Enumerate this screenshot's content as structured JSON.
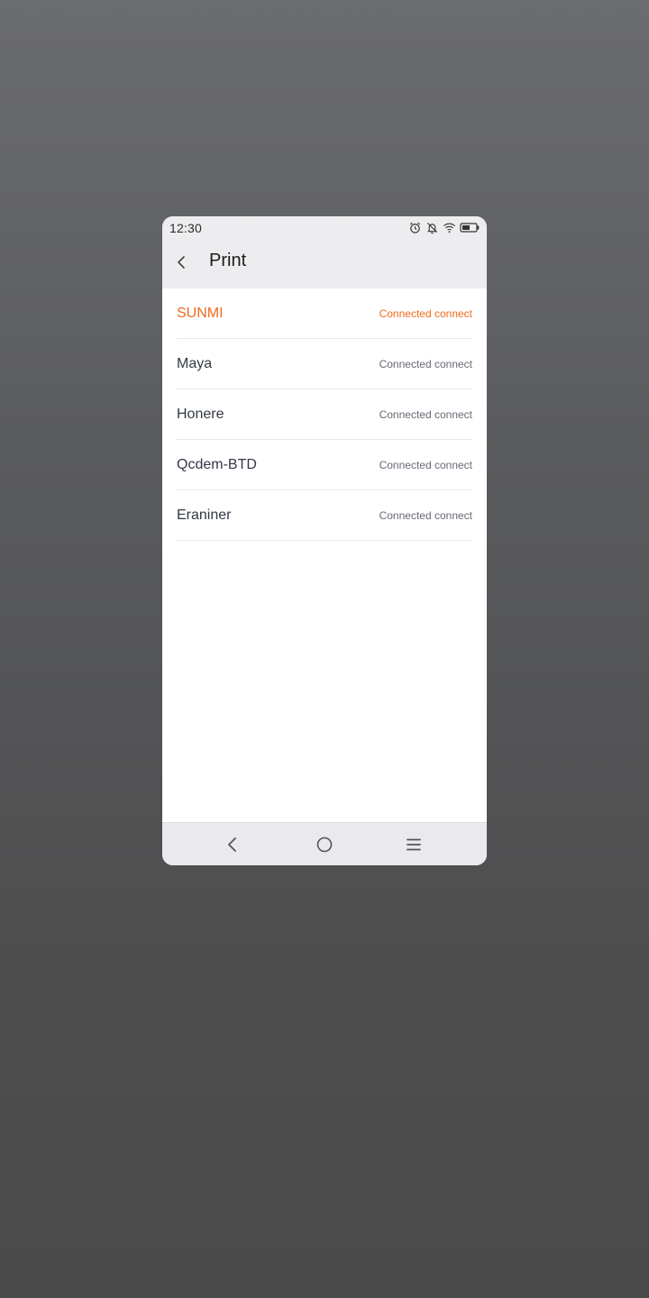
{
  "status_bar": {
    "time": "12:30",
    "icons": [
      "alarm-icon",
      "bell-off-icon",
      "wifi-icon",
      "battery-icon"
    ]
  },
  "header": {
    "back_icon": "chevron-left-icon",
    "title": "Print"
  },
  "printers": [
    {
      "name": "SUNMI",
      "status": "Connected connect",
      "selected": true
    },
    {
      "name": "Maya",
      "status": "Connected connect",
      "selected": false
    },
    {
      "name": "Honere",
      "status": "Connected connect",
      "selected": false
    },
    {
      "name": "Qcdem-BTD",
      "status": "Connected connect",
      "selected": false
    },
    {
      "name": "Eraniner",
      "status": "Connected connect",
      "selected": false
    }
  ],
  "nav_bar": {
    "icons": [
      "nav-back-icon",
      "nav-home-icon",
      "nav-menu-icon"
    ]
  },
  "colors": {
    "accent": "#f06a1a",
    "header_bg": "#ededef",
    "text_primary": "#333844",
    "text_secondary": "#666a74"
  }
}
